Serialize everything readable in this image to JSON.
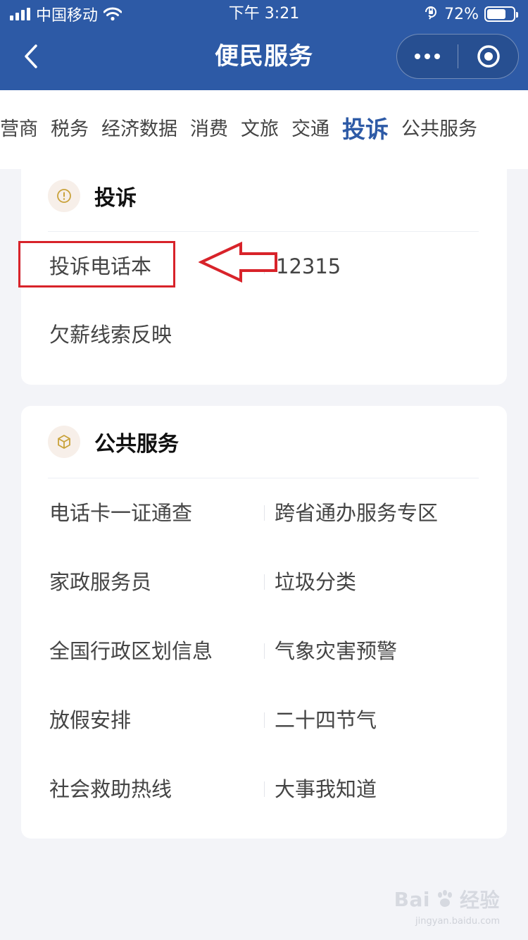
{
  "status_bar": {
    "carrier": "中国移动",
    "time": "下午 3:21",
    "battery_percent": "72%",
    "battery_level": 0.72
  },
  "nav": {
    "title": "便民服务",
    "back_icon": "chevron-left-icon",
    "more_icon": "more-dots-icon",
    "close_icon": "target-close-icon"
  },
  "tabs": [
    {
      "label": "营商",
      "active": false
    },
    {
      "label": "税务",
      "active": false
    },
    {
      "label": "经济数据",
      "active": false
    },
    {
      "label": "消费",
      "active": false
    },
    {
      "label": "文旅",
      "active": false
    },
    {
      "label": "交通",
      "active": false
    },
    {
      "label": "投诉",
      "active": true
    },
    {
      "label": "公共服务",
      "active": false
    }
  ],
  "complaint_section": {
    "title": "投诉",
    "icon": "alert-icon",
    "items": [
      "投诉电话本",
      "12315",
      "欠薪线索反映"
    ]
  },
  "public_section": {
    "title": "公共服务",
    "icon": "box-icon",
    "items": [
      "电话卡一证通查",
      "跨省通办服务专区",
      "家政服务员",
      "垃圾分类",
      "全国行政区划信息",
      "气象灾害预警",
      "放假安排",
      "二十四节气",
      "社会救助热线",
      "大事我知道"
    ]
  },
  "watermark": {
    "brand": "Bai",
    "brand_suffix": "经验",
    "url": "jingyan.baidu.com"
  },
  "colors": {
    "primary": "#2d5aa6",
    "highlight_red": "#d8232a",
    "icon_gold": "#c9a23a"
  }
}
